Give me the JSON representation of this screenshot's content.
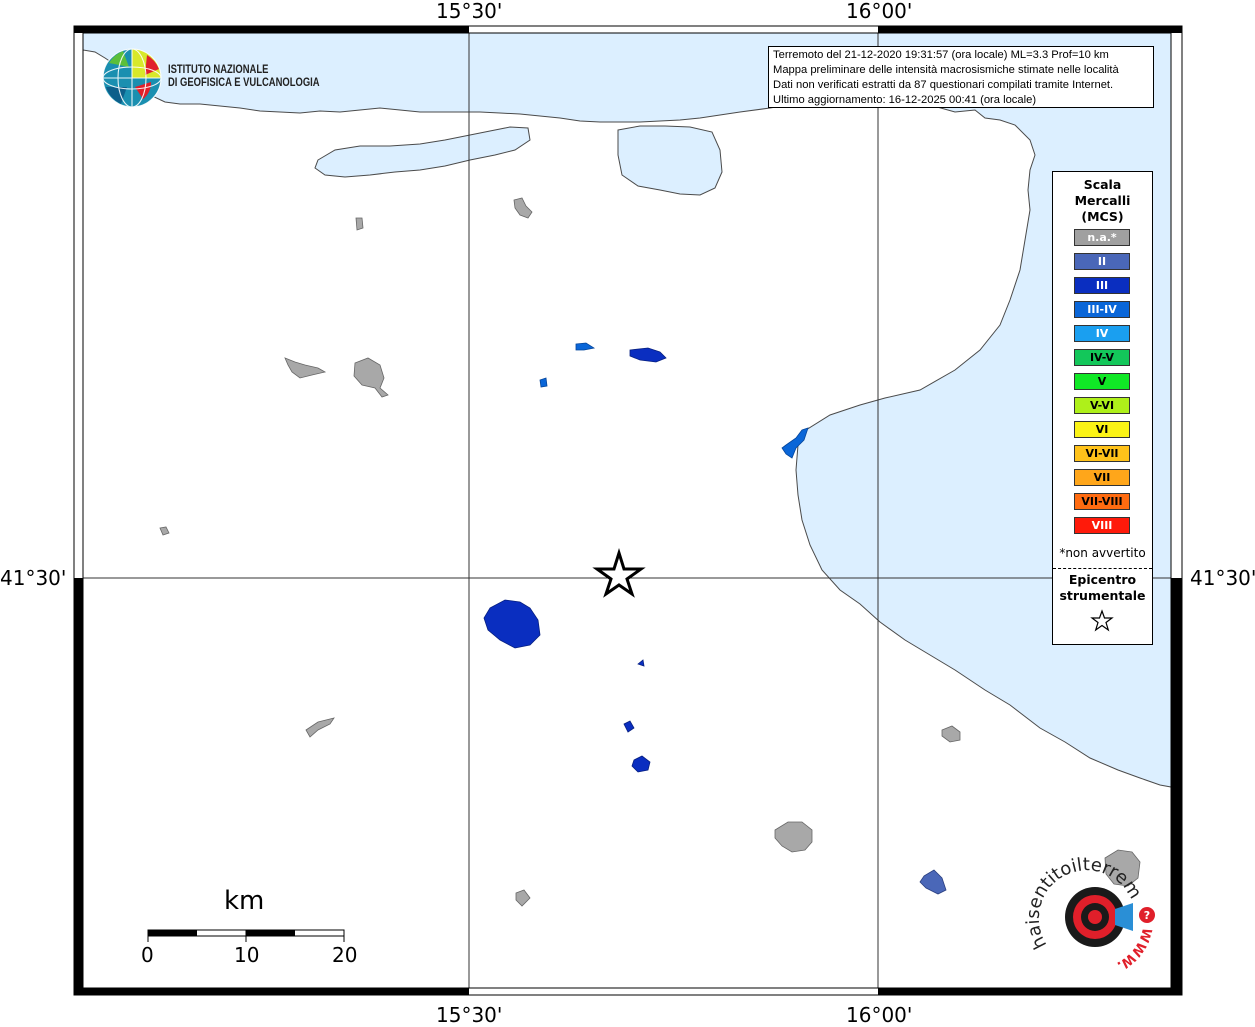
{
  "map": {
    "lon_labels": [
      "15°30'",
      "16°00'"
    ],
    "lat_labels": [
      "41°30'"
    ],
    "sea_color": "#dcefff",
    "land_color": "#ffffff"
  },
  "info": {
    "line1": "Terremoto del 21-12-2020 19:31:57 (ora locale) ML=3.3 Prof=10 km",
    "line2": "Mappa preliminare delle intensità macrosismiche stimate nelle località",
    "line3": "Dati non verificati estratti da 87 questionari compilati tramite Internet.",
    "line4": "Ultimo aggiornamento: 16-12-2025 00:41 (ora locale)"
  },
  "logo": {
    "line1": "ISTITUTO NAZIONALE",
    "line2": "DI GEOFISICA E VULCANOLOGIA"
  },
  "legend": {
    "title1": "Scala",
    "title2": "Mercalli",
    "title3": "(MCS)",
    "levels": [
      {
        "label": "n.a.*",
        "color": "#a0a0a0",
        "text_color": "#ffffff"
      },
      {
        "label": "II",
        "color": "#4a67b8",
        "text_color": "#ffffff"
      },
      {
        "label": "III",
        "color": "#0a2ec0",
        "text_color": "#ffffff"
      },
      {
        "label": "III-IV",
        "color": "#0a66d8",
        "text_color": "#ffffff"
      },
      {
        "label": "IV",
        "color": "#1a9ff0",
        "text_color": "#ffffff"
      },
      {
        "label": "IV-V",
        "color": "#13c75a",
        "text_color": "#000000"
      },
      {
        "label": "V",
        "color": "#10e826",
        "text_color": "#000000"
      },
      {
        "label": "V-VI",
        "color": "#aef01a",
        "text_color": "#000000"
      },
      {
        "label": "VI",
        "color": "#fbf316",
        "text_color": "#000000"
      },
      {
        "label": "VI-VII",
        "color": "#ffc21a",
        "text_color": "#000000"
      },
      {
        "label": "VII",
        "color": "#ffa61a",
        "text_color": "#000000"
      },
      {
        "label": "VII-VIII",
        "color": "#ff6b10",
        "text_color": "#000000"
      },
      {
        "label": "VIII",
        "color": "#ff1a0a",
        "text_color": "#ffffff"
      }
    ],
    "note": "*non avvertito",
    "epicentre1": "Epicentro",
    "epicentre2": "strumentale"
  },
  "scalebar": {
    "unit": "km",
    "labels": [
      "0",
      "10",
      "20"
    ]
  },
  "badge": {
    "text": "haisentitoilterremoto.it",
    "url_text": "WWW.",
    "question": "?"
  }
}
